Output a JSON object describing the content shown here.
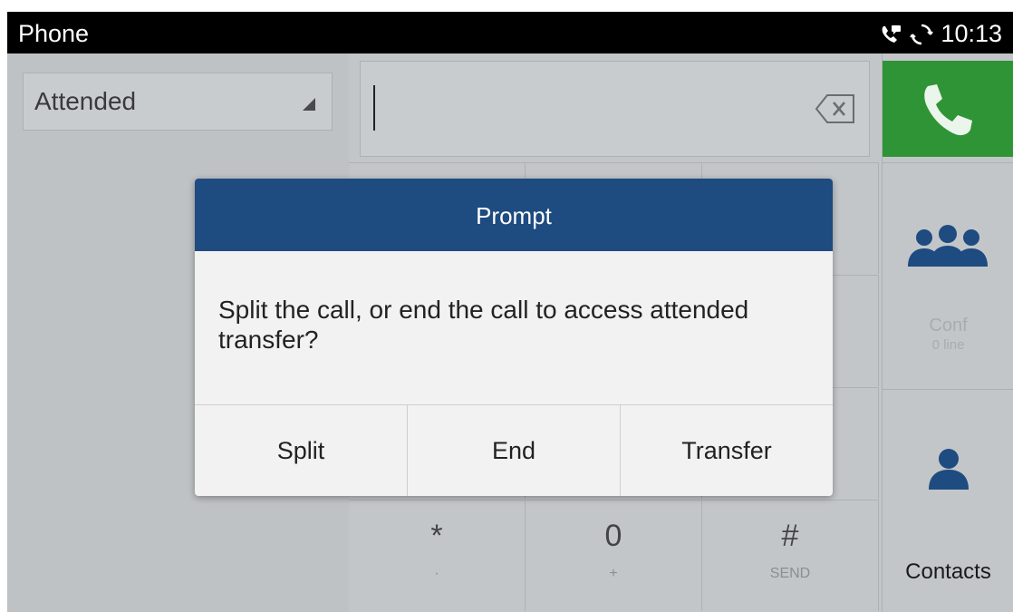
{
  "statusbar": {
    "title": "Phone",
    "time": "10:13"
  },
  "left_panel": {
    "transfer_mode": "Attended"
  },
  "dialer": {
    "number_value": "",
    "keys": [
      {
        "main": "*",
        "sub": "·"
      },
      {
        "main": "0",
        "sub": "+"
      },
      {
        "main": "#",
        "sub": "SEND"
      }
    ]
  },
  "right_column": {
    "conf_label": "Conf",
    "conf_sub": "0 line",
    "contacts_label": "Contacts"
  },
  "dialog": {
    "title": "Prompt",
    "message": "Split the call, or end the call to access attended transfer?",
    "buttons": {
      "split": "Split",
      "end": "End",
      "transfer": "Transfer"
    }
  },
  "colors": {
    "status_bar": "#000000",
    "dialog_header": "#1e4b80",
    "call_button": "#2f9436",
    "contact_icon": "#1e4b80"
  },
  "icons": [
    "call-status-icon",
    "sync-icon",
    "dropdown-arrow-icon",
    "backspace-icon",
    "phone-icon",
    "conference-icon",
    "contact-icon"
  ]
}
